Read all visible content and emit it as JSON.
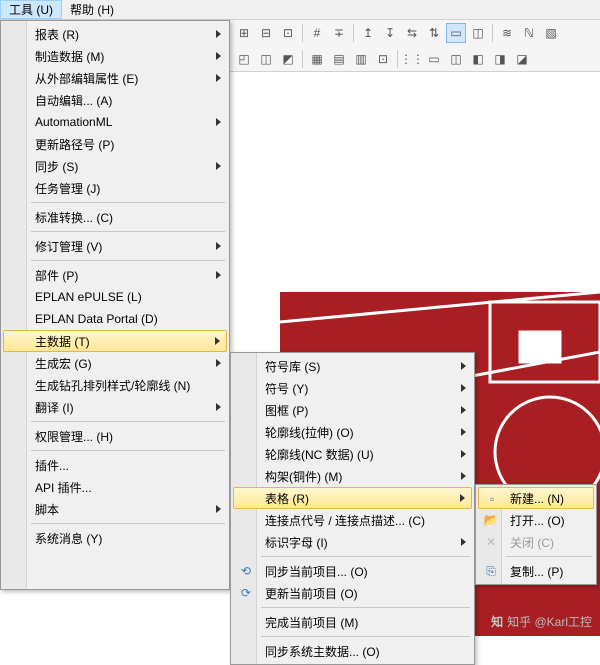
{
  "menubar": {
    "tools": "工具 (U)",
    "help": "帮助 (H)"
  },
  "tools_menu": {
    "reports": "报表 (R)",
    "mfg": "制造数据 (M)",
    "ext_edit": "从外部编辑属性 (E)",
    "auto_edit": "自动编辑... (A)",
    "automationml": "AutomationML",
    "update_path": "更新路径号 (P)",
    "sync": "同步 (S)",
    "task_mgr": "任务管理 (J)",
    "std_conv": "标准转换... (C)",
    "revision": "修订管理 (V)",
    "parts": "部件 (P)",
    "epulse": "EPLAN ePULSE (L)",
    "portal": "EPLAN Data Portal (D)",
    "master": "主数据 (T)",
    "gen_macro": "生成宏 (G)",
    "gen_drill": "生成钻孔排列样式/轮廓线 (N)",
    "translate": "翻译 (I)",
    "rights": "权限管理... (H)",
    "addins": "插件...",
    "api_addins": "API 插件...",
    "scripts": "脚本",
    "sys_msgs": "系统消息 (Y)"
  },
  "master_menu": {
    "symlib": "符号库 (S)",
    "symbol": "符号 (Y)",
    "frame": "图框 (P)",
    "outline_stretch": "轮廓线(拉伸) (O)",
    "outline_nc": "轮廓线(NC 数据) (U)",
    "frame_copper": "构架(铜件) (M)",
    "forms": "表格 (R)",
    "conn_pts": "连接点代号 / 连接点描述... (C)",
    "ident": "标识字母 (I)",
    "sync_cur": "同步当前项目... (O)",
    "update_cur": "更新当前项目 (O)",
    "complete_cur": "完成当前项目 (M)",
    "sync_sys": "同步系统主数据... (O)"
  },
  "forms_menu": {
    "new": "新建... (N)",
    "open": "打开... (O)",
    "close": "关闭 (C)",
    "copy": "复制... (P)"
  },
  "watermark": "知乎 @Karl工控"
}
